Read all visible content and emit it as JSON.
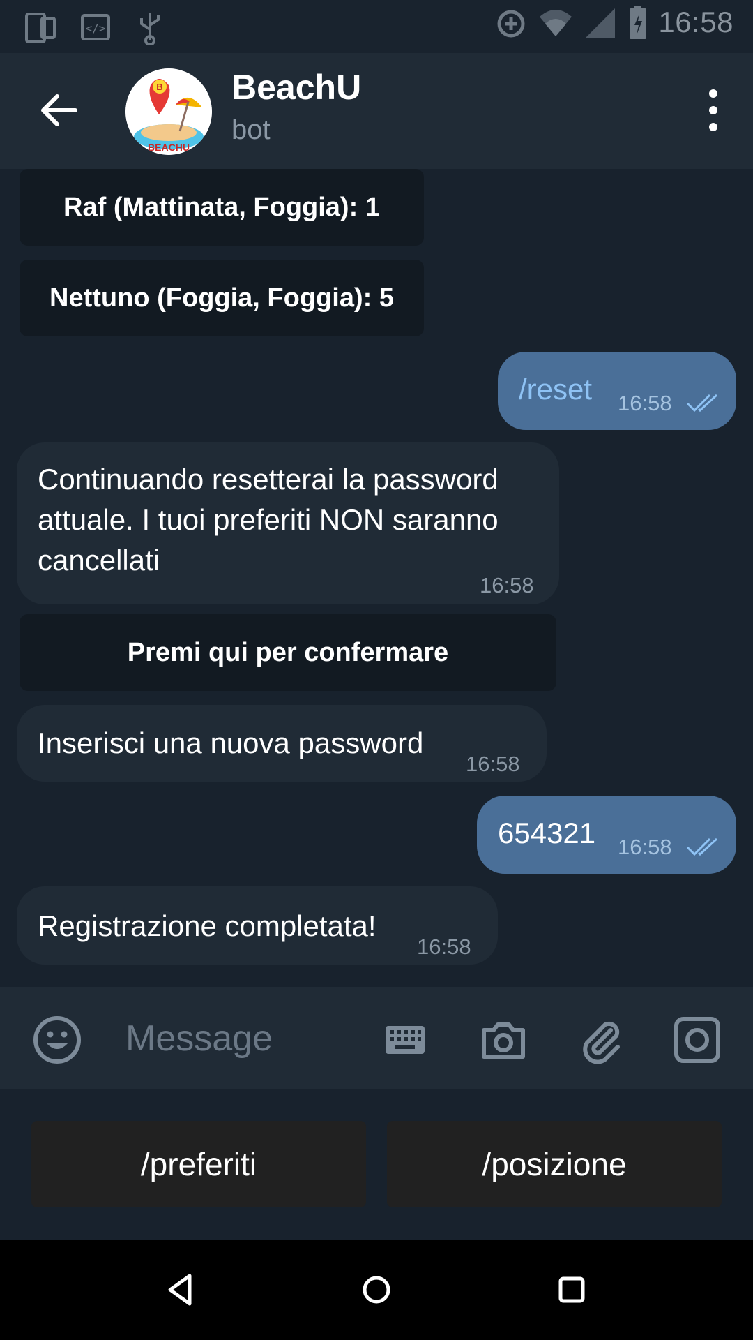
{
  "status_bar": {
    "time": "16:58"
  },
  "header": {
    "title": "BeachU",
    "subtitle": "bot",
    "avatar_text": "BEACHU"
  },
  "messages": {
    "inline_btn_1": "Raf (Mattinata, Foggia): 1",
    "inline_btn_2": "Nettuno (Foggia, Foggia): 5",
    "out_1_text": "/reset",
    "out_1_time": "16:58",
    "in_1_text": "Continuando resetterai la password attuale. I tuoi preferiti NON saranno cancellati",
    "in_1_time": "16:58",
    "inline_btn_3": "Premi qui per confermare",
    "in_2_text": "Inserisci una nuova password",
    "in_2_time": "16:58",
    "out_2_text": "654321",
    "out_2_time": "16:58",
    "in_3_text": "Registrazione completata!",
    "in_3_time": "16:58"
  },
  "input": {
    "placeholder": "Message"
  },
  "bot_keyboard": {
    "left": "/preferiti",
    "right": "/posizione"
  },
  "colors": {
    "outgoing_bubble": "#4a6f98",
    "incoming_bubble": "#202b36",
    "link": "#8fc3f5"
  }
}
